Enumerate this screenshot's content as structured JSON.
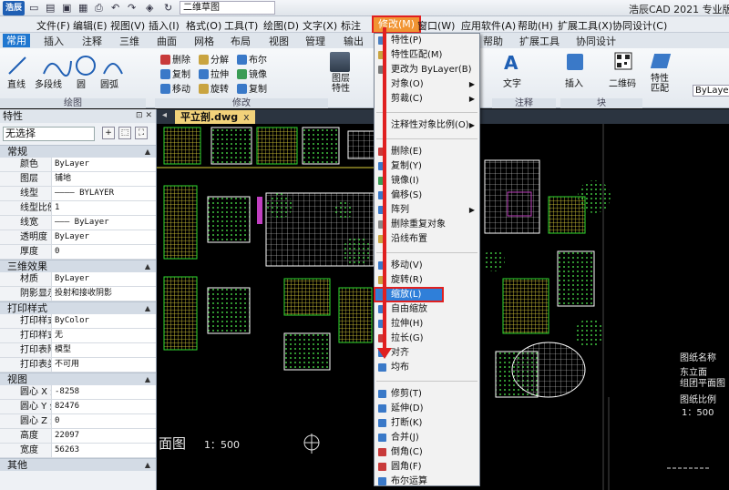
{
  "titlebar": {
    "logo": "浩辰",
    "title_input": "二维草图",
    "app_title": "浩辰CAD 2021 专业版"
  },
  "menubar": {
    "items": [
      "文件(F)",
      "编辑(E)",
      "视图(V)",
      "插入(I)",
      "格式(O)",
      "工具(T)",
      "绘图(D)",
      "文字(X)",
      "标注",
      "修改(M)",
      "窗口(W)",
      "应用软件(A)",
      "帮助(H)",
      "扩展工具(X)",
      "协同设计(C)"
    ],
    "highlight_label": "修改(M)"
  },
  "ribbon_tabs": [
    "常用",
    "插入",
    "注释",
    "三维",
    "曲面",
    "网格",
    "布局",
    "视图",
    "管理",
    "输出",
    "帮助",
    "扩展工具",
    "协同设计"
  ],
  "ribbon": {
    "draw": [
      "直线",
      "多段线",
      "圆",
      "圆弧"
    ],
    "modify": [
      "删除",
      "分解",
      "布尔",
      "复制",
      "拉伸",
      "镜像",
      "移动",
      "旋转",
      "复制"
    ],
    "layer_btn": "图层\n特性",
    "text_btn": "文字",
    "insert_btn": "插入",
    "qr_btn": "二维码",
    "match_btn": "特性\n匹配",
    "bylayer": "ByLayer",
    "groups": [
      "绘图",
      "修改",
      "注释",
      "块"
    ]
  },
  "doc_tab": {
    "name": "平立剖.dwg",
    "close": "x"
  },
  "panel": {
    "title": "特性",
    "selection": "无选择",
    "sections": [
      {
        "name": "常规",
        "rows": [
          [
            "颜色",
            "ByLayer"
          ],
          [
            "图层",
            "铺地"
          ],
          [
            "线型",
            "———— BYLAYER"
          ],
          [
            "线型比例",
            "1"
          ],
          [
            "线宽",
            "——— ByLayer"
          ],
          [
            "透明度",
            "ByLayer"
          ],
          [
            "厚度",
            "0"
          ]
        ]
      },
      {
        "name": "三维效果",
        "rows": [
          [
            "材质",
            "ByLayer"
          ],
          [
            "阴影显示",
            "投射和接收阴影"
          ]
        ]
      },
      {
        "name": "打印样式",
        "rows": [
          [
            "打印样式",
            "ByColor"
          ],
          [
            "打印样式表",
            "无"
          ],
          [
            "打印表附...",
            "模型"
          ],
          [
            "打印表类型",
            "不可用"
          ]
        ]
      },
      {
        "name": "视图",
        "rows": [
          [
            "圆心 X 坐标",
            "-8258"
          ],
          [
            "圆心 Y 坐标",
            "82476"
          ],
          [
            "圆心 Z 坐标",
            "0"
          ],
          [
            "高度",
            "22097"
          ],
          [
            "宽度",
            "56263"
          ]
        ]
      },
      {
        "name": "其他",
        "rows": []
      }
    ]
  },
  "canvas": {
    "bottom_title": "面图",
    "scale": "1：500",
    "right_notes": [
      "图纸名称",
      "东立面",
      "组团平面图",
      "图纸比例",
      "1：500"
    ]
  },
  "dropdown": {
    "items": [
      {
        "label": "特性(P)",
        "color": "#4a7fc1"
      },
      {
        "label": "特性匹配(M)",
        "color": "#c9a440"
      },
      {
        "label": "更改为 ByLayer(B)",
        "color": "#777777"
      },
      {
        "label": "对象(O)",
        "color": "",
        "sub": "▶"
      },
      {
        "label": "剪裁(C)",
        "color": "",
        "sub": "▶"
      },
      {
        "sep": true
      },
      {
        "label": "注释性对象比例(O)",
        "color": "",
        "sub": "▶"
      },
      {
        "sep": true
      },
      {
        "label": "删除(E)",
        "color": "#c83a3a"
      },
      {
        "label": "复制(Y)",
        "color": "#3a79c8"
      },
      {
        "label": "镜像(I)",
        "color": "#3a9c55"
      },
      {
        "label": "偏移(S)",
        "color": "#3a79c8"
      },
      {
        "label": "阵列",
        "color": "#3a79c8",
        "sub": "▶"
      },
      {
        "label": "删除重复对象",
        "color": "#888888"
      },
      {
        "label": "沿线布置",
        "color": "#c9a440"
      },
      {
        "sep": true
      },
      {
        "label": "移动(V)",
        "color": "#3a79c8"
      },
      {
        "label": "旋转(R)",
        "color": "#c9a440"
      },
      {
        "label": "缩放(L)",
        "color": "#3a79c8",
        "hl": true
      },
      {
        "label": "自由缩放",
        "color": "#3a79c8"
      },
      {
        "label": "拉伸(H)",
        "color": "#3a79c8"
      },
      {
        "label": "拉长(G)",
        "color": "#c83a3a"
      },
      {
        "label": "对齐",
        "color": "#3a79c8"
      },
      {
        "label": "均布",
        "color": "#3a79c8"
      },
      {
        "sep": true
      },
      {
        "label": "修剪(T)",
        "color": "#3a79c8"
      },
      {
        "label": "延伸(D)",
        "color": "#3a79c8"
      },
      {
        "label": "打断(K)",
        "color": "#3a79c8"
      },
      {
        "label": "合并(J)",
        "color": "#3a79c8"
      },
      {
        "label": "倒角(C)",
        "color": "#c83a3a"
      },
      {
        "label": "圆角(F)",
        "color": "#c83a3a"
      },
      {
        "label": "布尔运算",
        "color": "#3a79c8"
      }
    ]
  }
}
